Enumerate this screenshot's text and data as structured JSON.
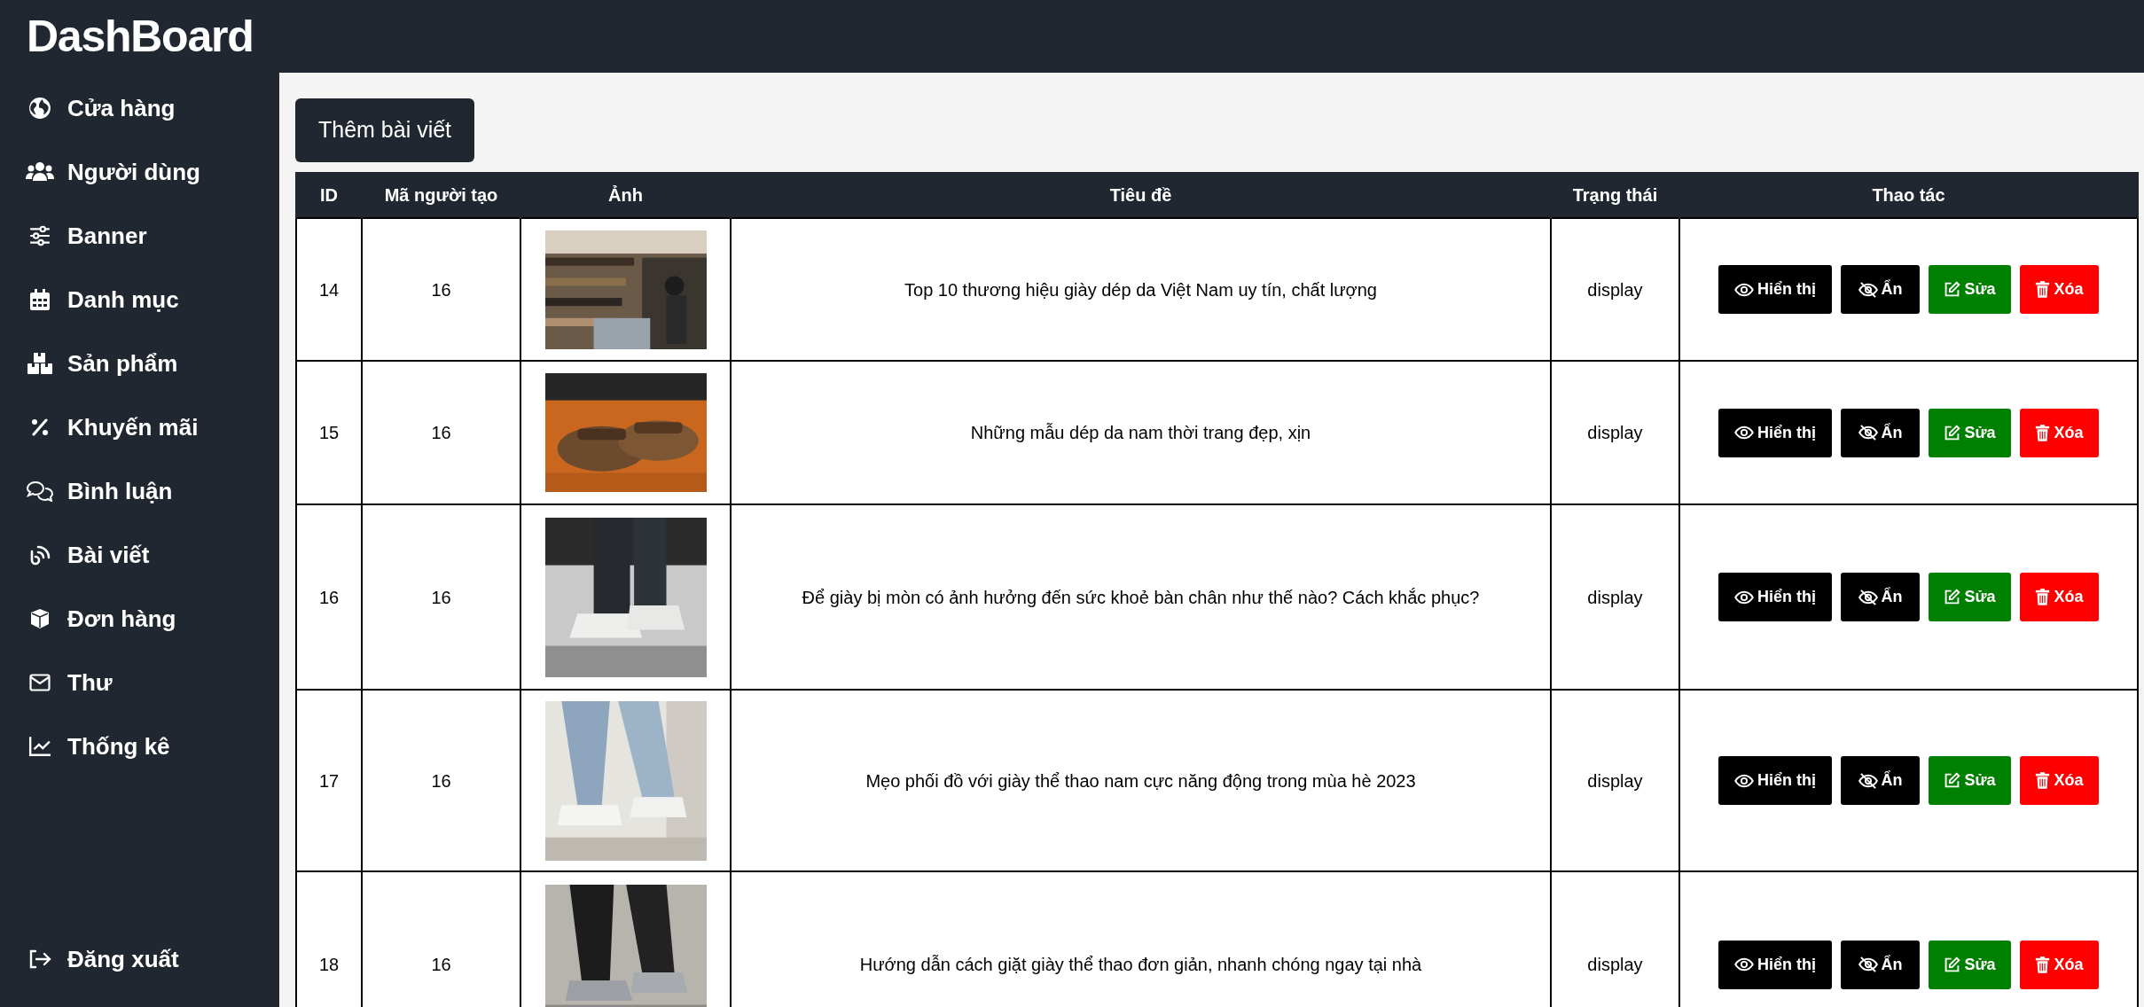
{
  "sidebar": {
    "title": "DashBoard",
    "items": [
      {
        "label": "Cửa hàng",
        "kind": "globe"
      },
      {
        "label": "Người dùng",
        "kind": "users"
      },
      {
        "label": "Banner",
        "kind": "sliders"
      },
      {
        "label": "Danh mục",
        "kind": "calendar"
      },
      {
        "label": "Sản phẩm",
        "kind": "boxes"
      },
      {
        "label": "Khuyến mãi",
        "kind": "percent"
      },
      {
        "label": "Bình luận",
        "kind": "comments"
      },
      {
        "label": "Bài viết",
        "kind": "blog"
      },
      {
        "label": "Đơn hàng",
        "kind": "cube"
      },
      {
        "label": "Thư",
        "kind": "mail"
      },
      {
        "label": "Thống kê",
        "kind": "chart"
      }
    ],
    "logout": {
      "label": "Đăng xuất",
      "kind": "logout"
    }
  },
  "add_button": "Thêm bài viết",
  "table": {
    "columns": [
      "ID",
      "Mã người tạo",
      "Ảnh",
      "Tiêu đề",
      "Trạng thái",
      "Thao tác"
    ],
    "rows": [
      {
        "id": "14",
        "creator_id": "16",
        "title": "Top 10 thương hiệu giày dép da Việt Nam uy tín, chất lượng",
        "status": "display",
        "actions": [
          {
            "kind": "show",
            "label": "Hiển thị"
          },
          {
            "kind": "hide",
            "label": "Ẩn"
          },
          {
            "kind": "edit",
            "label": "Sửa"
          },
          {
            "kind": "delete",
            "label": "Xóa"
          }
        ]
      },
      {
        "id": "15",
        "creator_id": "16",
        "title": "Những mẫu dép da nam thời trang đẹp, xịn",
        "status": "display",
        "actions": [
          {
            "kind": "show",
            "label": "Hiển thị"
          },
          {
            "kind": "hide",
            "label": "Ẩn"
          },
          {
            "kind": "edit",
            "label": "Sửa"
          },
          {
            "kind": "delete",
            "label": "Xóa"
          }
        ]
      },
      {
        "id": "16",
        "creator_id": "16",
        "title": "Để giày bị mòn có ảnh hưởng đến sức khoẻ bàn chân như thế nào? Cách khắc phục?",
        "status": "display",
        "actions": [
          {
            "kind": "show",
            "label": "Hiển thị"
          },
          {
            "kind": "hide",
            "label": "Ẩn"
          },
          {
            "kind": "edit",
            "label": "Sửa"
          },
          {
            "kind": "delete",
            "label": "Xóa"
          }
        ]
      },
      {
        "id": "17",
        "creator_id": "16",
        "title": "Mẹo phối đồ với giày thể thao nam cực năng động trong mùa hè 2023",
        "status": "display",
        "actions": [
          {
            "kind": "show",
            "label": "Hiển thị"
          },
          {
            "kind": "hide",
            "label": "Ẩn"
          },
          {
            "kind": "edit",
            "label": "Sửa"
          },
          {
            "kind": "delete",
            "label": "Xóa"
          }
        ]
      },
      {
        "id": "18",
        "creator_id": "16",
        "title": "Hướng dẫn cách giặt giày thể thao đơn giản, nhanh chóng ngay tại nhà",
        "status": "display",
        "actions": [
          {
            "kind": "show",
            "label": "Hiển thị"
          },
          {
            "kind": "hide",
            "label": "Ẩn"
          },
          {
            "kind": "edit",
            "label": "Sửa"
          },
          {
            "kind": "delete",
            "label": "Xóa"
          }
        ]
      }
    ]
  }
}
